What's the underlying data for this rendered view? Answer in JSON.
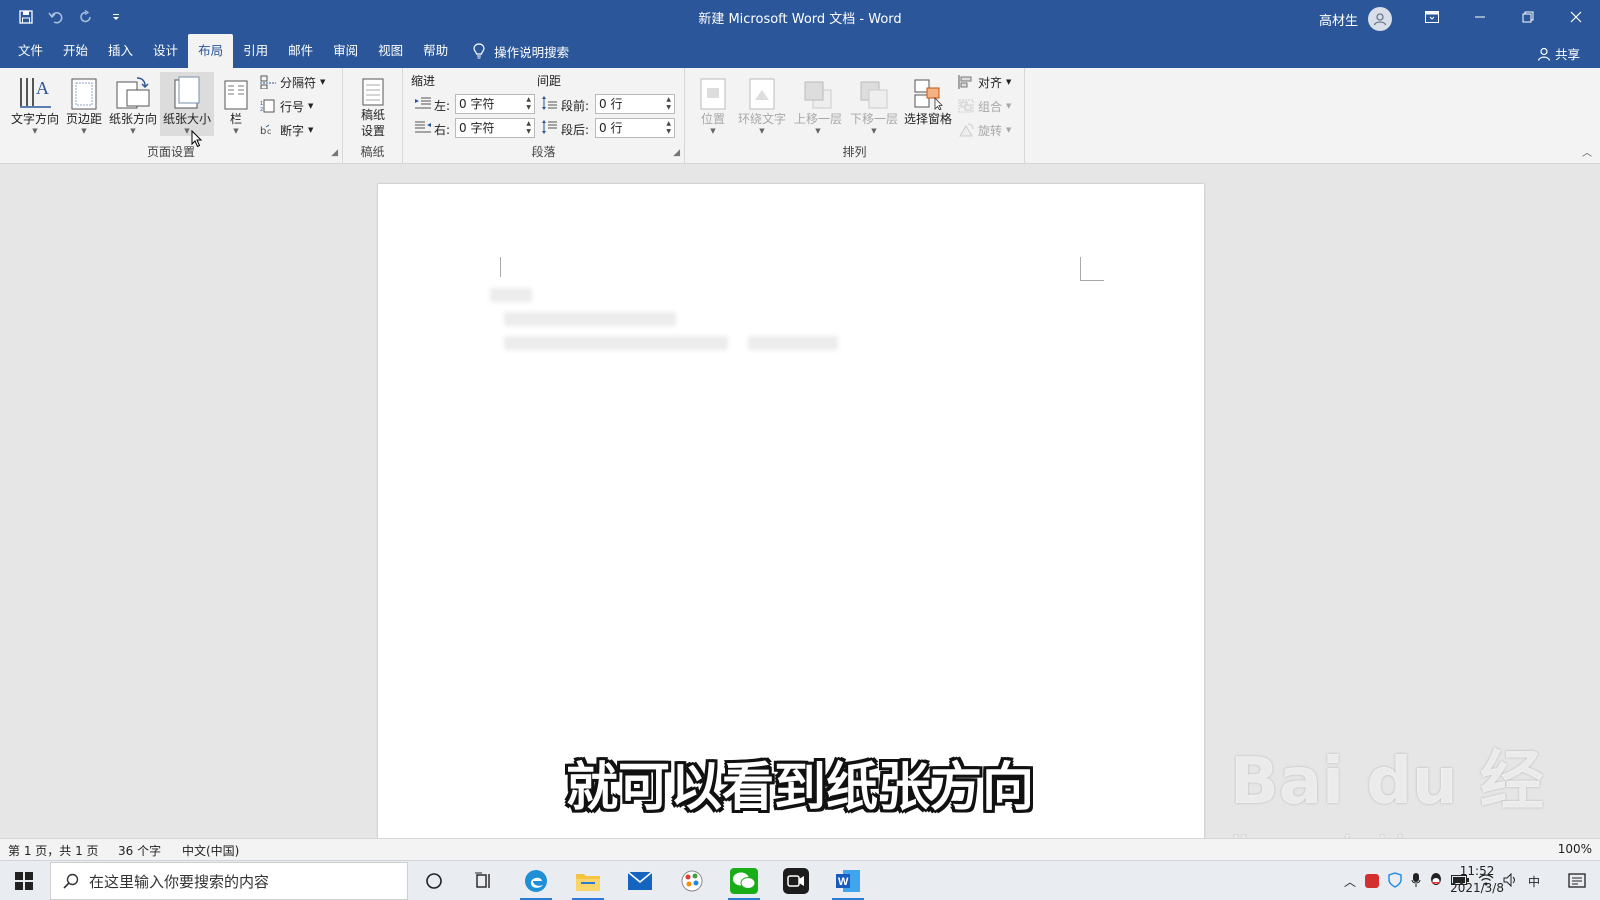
{
  "window": {
    "title": "新建 Microsoft Word 文档  -  Word",
    "user_name": "高材生"
  },
  "tabs": [
    {
      "label": "文件"
    },
    {
      "label": "开始"
    },
    {
      "label": "插入"
    },
    {
      "label": "设计"
    },
    {
      "label": "布局",
      "active": true
    },
    {
      "label": "引用"
    },
    {
      "label": "邮件"
    },
    {
      "label": "审阅"
    },
    {
      "label": "视图"
    },
    {
      "label": "帮助"
    }
  ],
  "tell_me": "操作说明搜索",
  "share_label": "共享",
  "ribbon": {
    "page_setup": {
      "group_label": "页面设置",
      "text_direction": "文字方向",
      "margins": "页边距",
      "orientation": "纸张方向",
      "size": "纸张大小",
      "columns": "栏",
      "breaks": "分隔符",
      "line_numbers": "行号",
      "hyphenation": "断字"
    },
    "manuscript": {
      "group_label": "稿纸",
      "button_line1": "稿纸",
      "button_line2": "设置"
    },
    "paragraph": {
      "group_label": "段落",
      "indent_label": "缩进",
      "spacing_label": "间距",
      "left_label": "左:",
      "left_value": "0 字符",
      "right_label": "右:",
      "right_value": "0 字符",
      "before_label": "段前:",
      "before_value": "0 行",
      "after_label": "段后:",
      "after_value": "0 行"
    },
    "arrange": {
      "group_label": "排列",
      "position": "位置",
      "wrap_text": "环绕文字",
      "bring_forward": "上移一层",
      "send_backward": "下移一层",
      "selection_pane": "选择窗格",
      "align": "对齐",
      "group": "组合",
      "rotate": "旋转"
    }
  },
  "caption": "就可以看到纸张方向",
  "watermark": {
    "brand": "Bai du 经验",
    "url": "jingyan.baidu.com"
  },
  "statusbar": {
    "page": "第 1 页，共 1 页",
    "words": "36 个字",
    "language": "中文(中国)",
    "zoom": "100%"
  },
  "taskbar": {
    "search_placeholder": "在这里输入你要搜索的内容",
    "time": "11:52",
    "date": "2021/3/8",
    "ime": "中"
  },
  "colors": {
    "accent": "#2b579a",
    "ribbon_bg": "#f3f3f3",
    "doc_bg": "#e6e6e6"
  }
}
